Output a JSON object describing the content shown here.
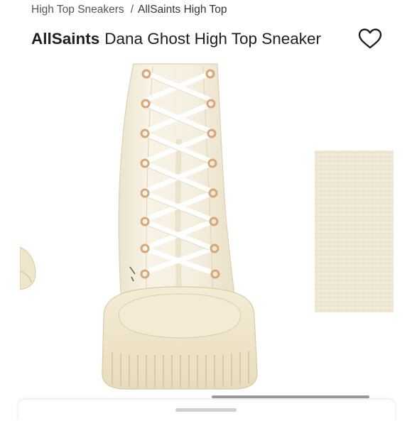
{
  "breadcrumb": {
    "items": [
      "High Top Sneakers",
      "AllSaints High Top"
    ],
    "separator": "/"
  },
  "product": {
    "brand": "AllSaints",
    "name": "Dana Ghost High Top Sneaker"
  },
  "icons": {
    "favorite": "heart-outline-icon"
  },
  "colors": {
    "canvas": "#f6f1e3",
    "sole": "#f1e8cf",
    "laces": "#ffffff",
    "eyelets": "#d7a778"
  }
}
